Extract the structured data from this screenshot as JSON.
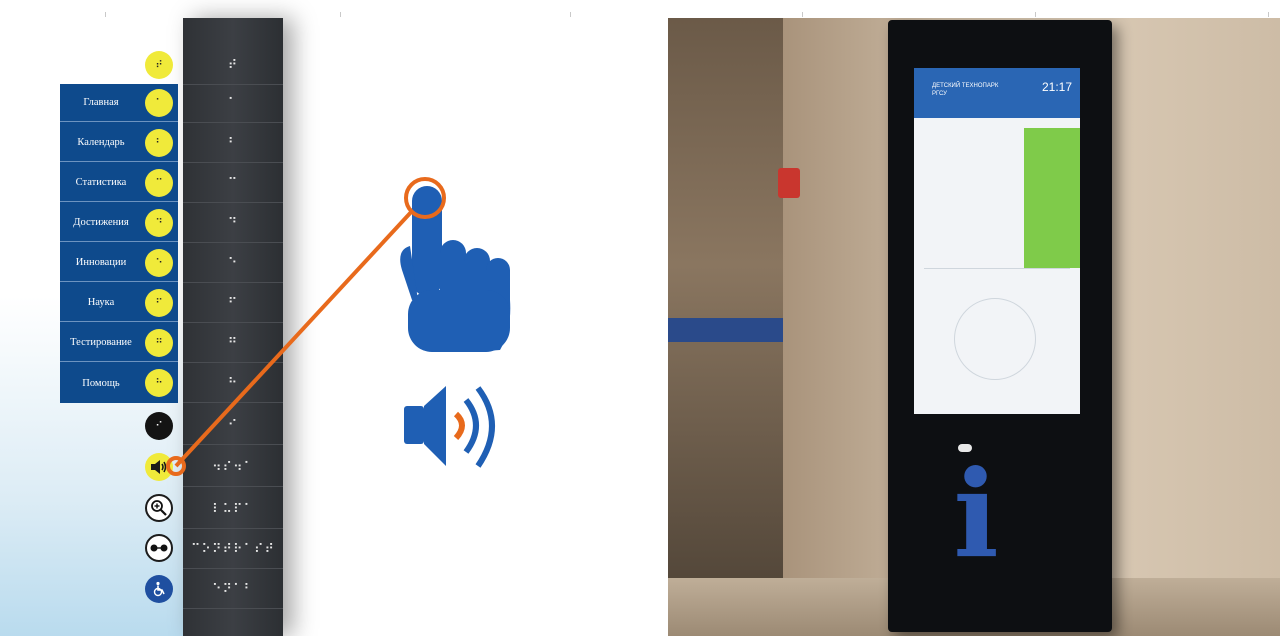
{
  "menu": {
    "items": [
      {
        "label": "Главная",
        "braille": "⠁"
      },
      {
        "label": "Календарь",
        "braille": "⠃"
      },
      {
        "label": "Статистика",
        "braille": "⠉"
      },
      {
        "label": "Достижения",
        "braille": "⠙"
      },
      {
        "label": "Инновации",
        "braille": "⠑"
      },
      {
        "label": "Наука",
        "braille": "⠋"
      },
      {
        "label": "Тестирование",
        "braille": "⠛"
      },
      {
        "label": "Помощь",
        "braille": "⠓"
      }
    ],
    "top_braille": "⠞",
    "controls_braille": [
      "⠊",
      "⠲⠎⠲⠁",
      "⠇⠥⠏⠁",
      "⠉⠕⠝⠞⠗⠁⠎⠞",
      "⠑⠝⠁⠃"
    ]
  },
  "icons": {
    "hand": "hand-touch-icon",
    "sound": "speaker-sound-icon",
    "zoom": "magnifier-icon",
    "contrast": "glasses-icon",
    "accessibility": "wheelchair-icon",
    "info": "info-icon"
  },
  "colors": {
    "yellow": "#f0ea3a",
    "menu_blue": "#0e4a8c",
    "braille_bg": "#33363a",
    "orange_accent": "#e86a1c",
    "icon_blue": "#1f5fb4"
  },
  "kiosk": {
    "time": "21:17",
    "title": "ДЕТСКИЙ ТЕХНОПАРК РГСУ"
  }
}
